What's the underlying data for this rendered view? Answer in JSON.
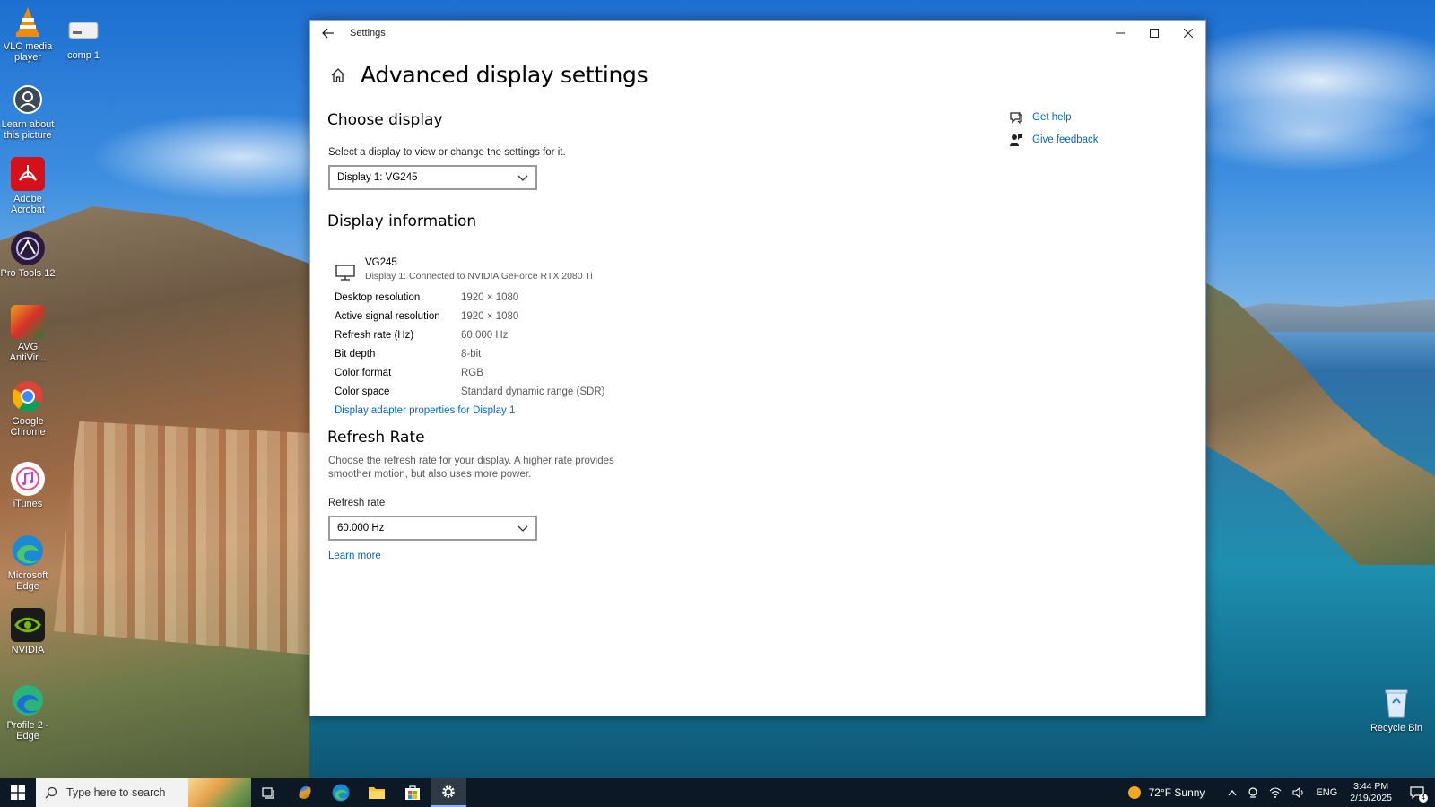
{
  "desktop_icons": [
    {
      "label": "VLC media player",
      "icon": "vlc-cone-icon",
      "color": "#f28a0e"
    },
    {
      "label": "comp 1",
      "icon": "drive-icon",
      "color": "#e0e0e0"
    },
    {
      "label": "Learn about this picture",
      "icon": "camera-icon",
      "color": "#3c4a55"
    },
    {
      "label": "Adobe Acrobat",
      "icon": "acrobat-icon",
      "color": "#d4101a"
    },
    {
      "label": "Pro Tools 12",
      "icon": "protools-icon",
      "color": "#2a1b3d"
    },
    {
      "label": "AVG AntiVir...",
      "icon": "avg-icon",
      "color": "#e8a21e"
    },
    {
      "label": "Google Chrome",
      "icon": "chrome-icon",
      "color": "#4285f4"
    },
    {
      "label": "iTunes",
      "icon": "itunes-icon",
      "color": "#f04d7e"
    },
    {
      "label": "Microsoft Edge",
      "icon": "edge-icon",
      "color": "#1b8ad3"
    },
    {
      "label": "NVIDIA",
      "icon": "nvidia-icon",
      "color": "#76b900"
    },
    {
      "label": "Profile 2 - Edge",
      "icon": "edge-profile-icon",
      "color": "#2bb37a"
    },
    {
      "label": "Recycle Bin",
      "icon": "recycle-bin-icon",
      "color": "#cfe3f5"
    }
  ],
  "window": {
    "title": "Settings",
    "page_title": "Advanced display settings",
    "choose_display": {
      "heading": "Choose display",
      "caption": "Select a display to view or change the settings for it.",
      "selected": "Display 1: VG245"
    },
    "display_info": {
      "heading": "Display information",
      "monitor_name": "VG245",
      "monitor_sub": "Display 1: Connected to NVIDIA GeForce RTX 2080 Ti",
      "rows": [
        {
          "key": "Desktop resolution",
          "value": "1920 × 1080"
        },
        {
          "key": "Active signal resolution",
          "value": "1920 × 1080"
        },
        {
          "key": "Refresh rate (Hz)",
          "value": "60.000 Hz"
        },
        {
          "key": "Bit depth",
          "value": "8-bit"
        },
        {
          "key": "Color format",
          "value": "RGB"
        },
        {
          "key": "Color space",
          "value": "Standard dynamic range (SDR)"
        }
      ],
      "adapter_link": "Display adapter properties for Display 1"
    },
    "refresh": {
      "heading": "Refresh Rate",
      "description_line1": "Choose the refresh rate for your display. A higher rate provides",
      "description_line2": "smoother motion, but also uses more power.",
      "field_label": "Refresh rate",
      "selected": "60.000 Hz",
      "learn_more": "Learn more"
    },
    "side": {
      "get_help": "Get help",
      "give_feedback": "Give feedback"
    }
  },
  "taskbar": {
    "search_placeholder": "Type here to search",
    "weather": "72°F  Sunny",
    "language": "ENG",
    "time": "3:44 PM",
    "date": "2/19/2025",
    "notification_count": "4"
  },
  "colors": {
    "link": "#0067c0",
    "taskbar": "#0c141e",
    "accent": "#7fb6ff"
  }
}
